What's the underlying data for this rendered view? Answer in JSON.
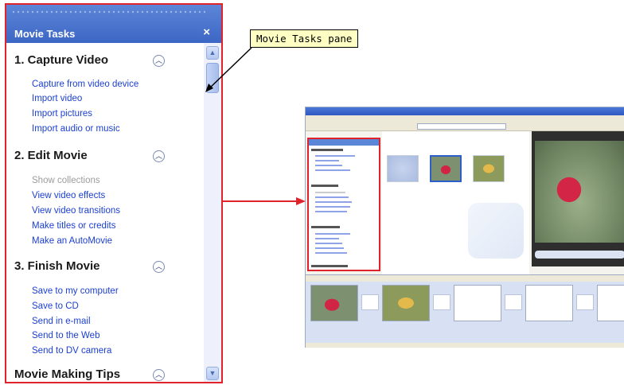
{
  "pane": {
    "title": "Movie Tasks",
    "close": "×",
    "sections": [
      {
        "heading": "1. Capture Video",
        "tasks": [
          {
            "label": "Capture from video device",
            "enabled": true
          },
          {
            "label": "Import video",
            "enabled": true
          },
          {
            "label": "Import pictures",
            "enabled": true
          },
          {
            "label": "Import audio or music",
            "enabled": true
          }
        ]
      },
      {
        "heading": "2. Edit Movie",
        "tasks": [
          {
            "label": "Show collections",
            "enabled": false
          },
          {
            "label": "View video effects",
            "enabled": true
          },
          {
            "label": "View video transitions",
            "enabled": true
          },
          {
            "label": "Make titles or credits",
            "enabled": true
          },
          {
            "label": "Make an AutoMovie",
            "enabled": true
          }
        ]
      },
      {
        "heading": "3. Finish Movie",
        "tasks": [
          {
            "label": "Save to my computer",
            "enabled": true
          },
          {
            "label": "Save to CD",
            "enabled": true
          },
          {
            "label": "Send in e-mail",
            "enabled": true
          },
          {
            "label": "Send to the Web",
            "enabled": true
          },
          {
            "label": "Send to DV camera",
            "enabled": true
          }
        ]
      },
      {
        "heading": "Movie Making Tips",
        "tasks": []
      }
    ]
  },
  "callout": {
    "text": "Movie Tasks pane"
  },
  "colors": {
    "highlight": "#e0232a",
    "link": "#1b3fd1",
    "disabled": "#9c9c9c",
    "callout_bg": "#ffffc4"
  }
}
